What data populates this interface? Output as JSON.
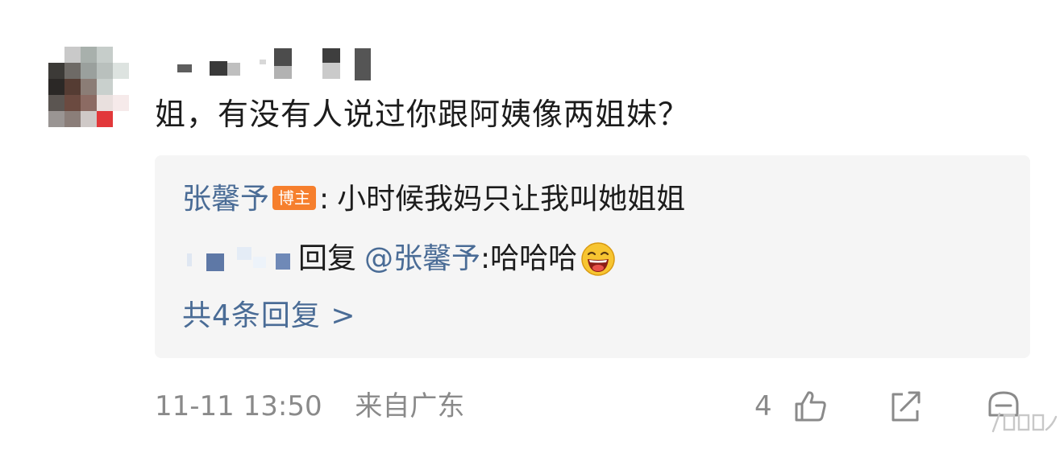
{
  "comment": {
    "text": "姐，有没有人说过你跟阿姨像两姐妹？"
  },
  "replies": {
    "first": {
      "author": "张馨予",
      "badge": "博主",
      "separator": ":",
      "text": "小时候我妈只让我叫她姐姐"
    },
    "second": {
      "reply_word": "回复",
      "mention": "@张馨予",
      "text": ":哈哈哈",
      "emoji_icon": "laughing-face-icon"
    },
    "view_all": "共4条回复 >"
  },
  "footer": {
    "timestamp": "11-11 13:50",
    "location": "来自广东",
    "like_count": "4"
  },
  "icons": {
    "like": "thumbs-up-icon",
    "share": "share-icon",
    "comment": "comment-icon"
  },
  "colors": {
    "link": "#4a6c96",
    "badge": "#f67f2d",
    "reply_bg": "#f5f5f5",
    "muted": "#8a8a8a"
  }
}
